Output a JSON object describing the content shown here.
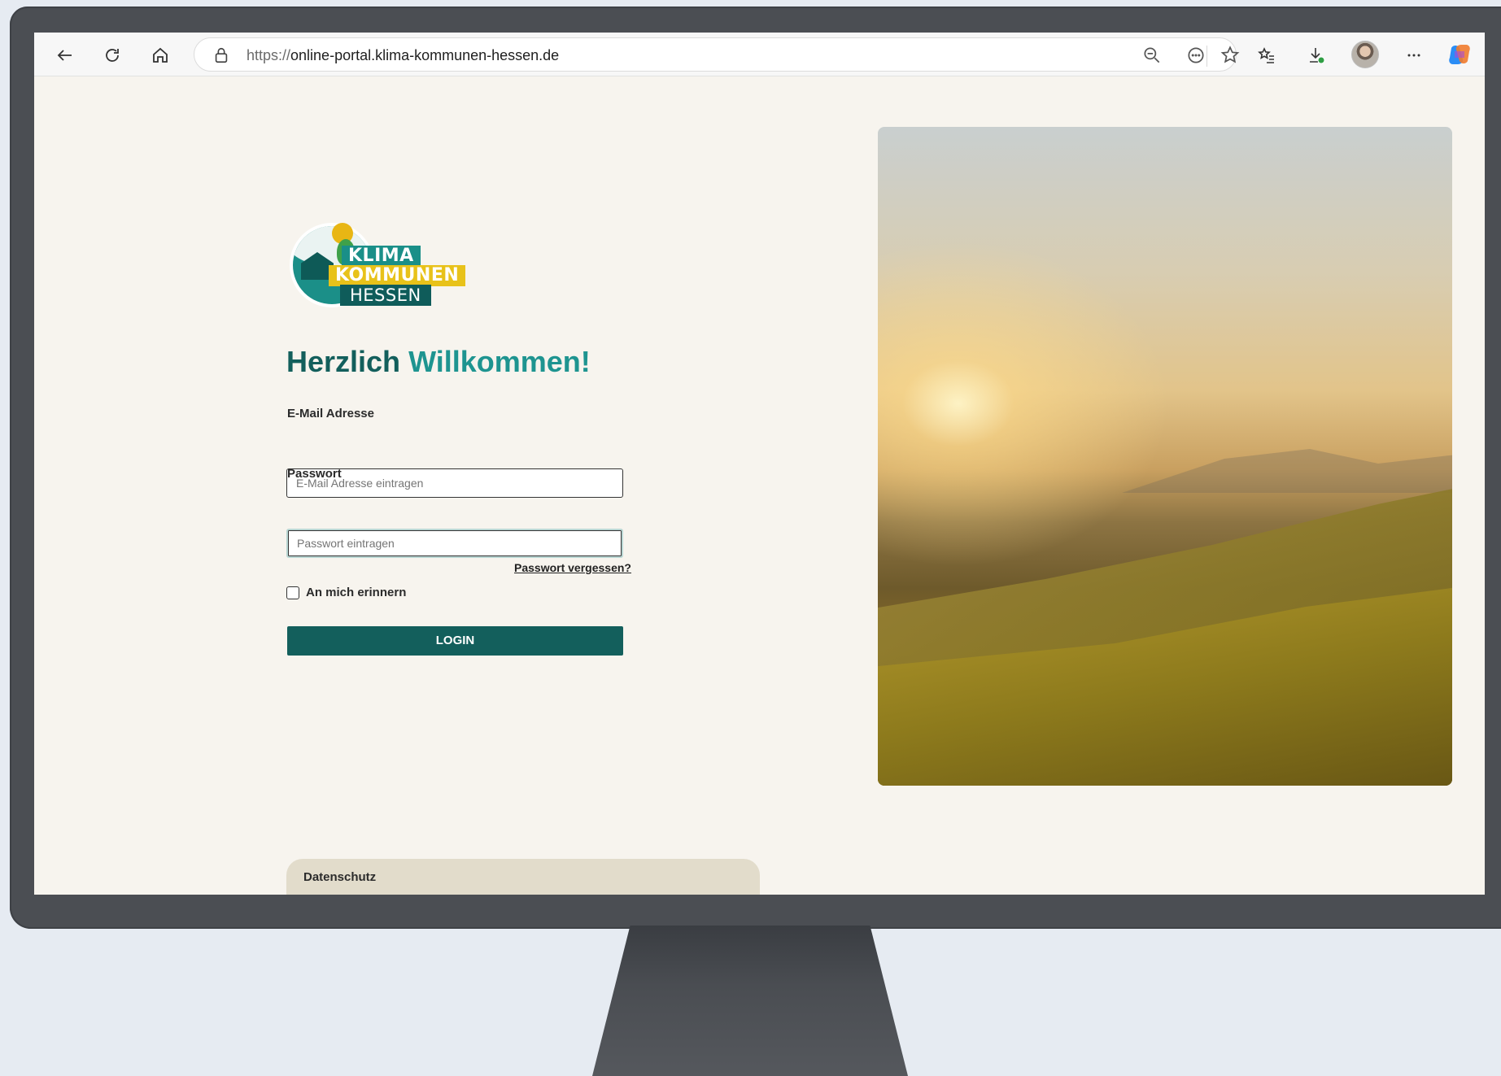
{
  "browser": {
    "url_scheme": "https://",
    "url_host": "online-portal.klima-kommunen-hessen.de",
    "icons": [
      "back-icon",
      "reload-icon",
      "home-icon",
      "site-info-icon",
      "zoom-out-icon",
      "more-site-icon",
      "favorite-star-icon",
      "favorites-list-icon",
      "downloads-icon",
      "profile-avatar",
      "more-menu-icon",
      "copilot-icon"
    ]
  },
  "logo": {
    "line1": "KLIMA",
    "line2": "KOMMUNEN",
    "line3": "HESSEN"
  },
  "login": {
    "welcome_part1": "Herzlich",
    "welcome_part2": "Willkommen!",
    "email_label": "E-Mail Adresse",
    "email_placeholder": "E-Mail Adresse eintragen",
    "email_value": "",
    "password_label": "Passwort",
    "password_placeholder": "Passwort eintragen",
    "password_value": "",
    "forgot_password": "Passwort vergessen?",
    "remember_label": "An mich erinnern",
    "remember_checked": false,
    "login_button": "LOGIN"
  },
  "footer": {
    "privacy_label": "Datenschutz"
  },
  "colors": {
    "primary": "#135f5c",
    "accent_teal": "#1e9490",
    "page_background": "#f7f4ee",
    "footer_tab": "#e2dccb"
  }
}
